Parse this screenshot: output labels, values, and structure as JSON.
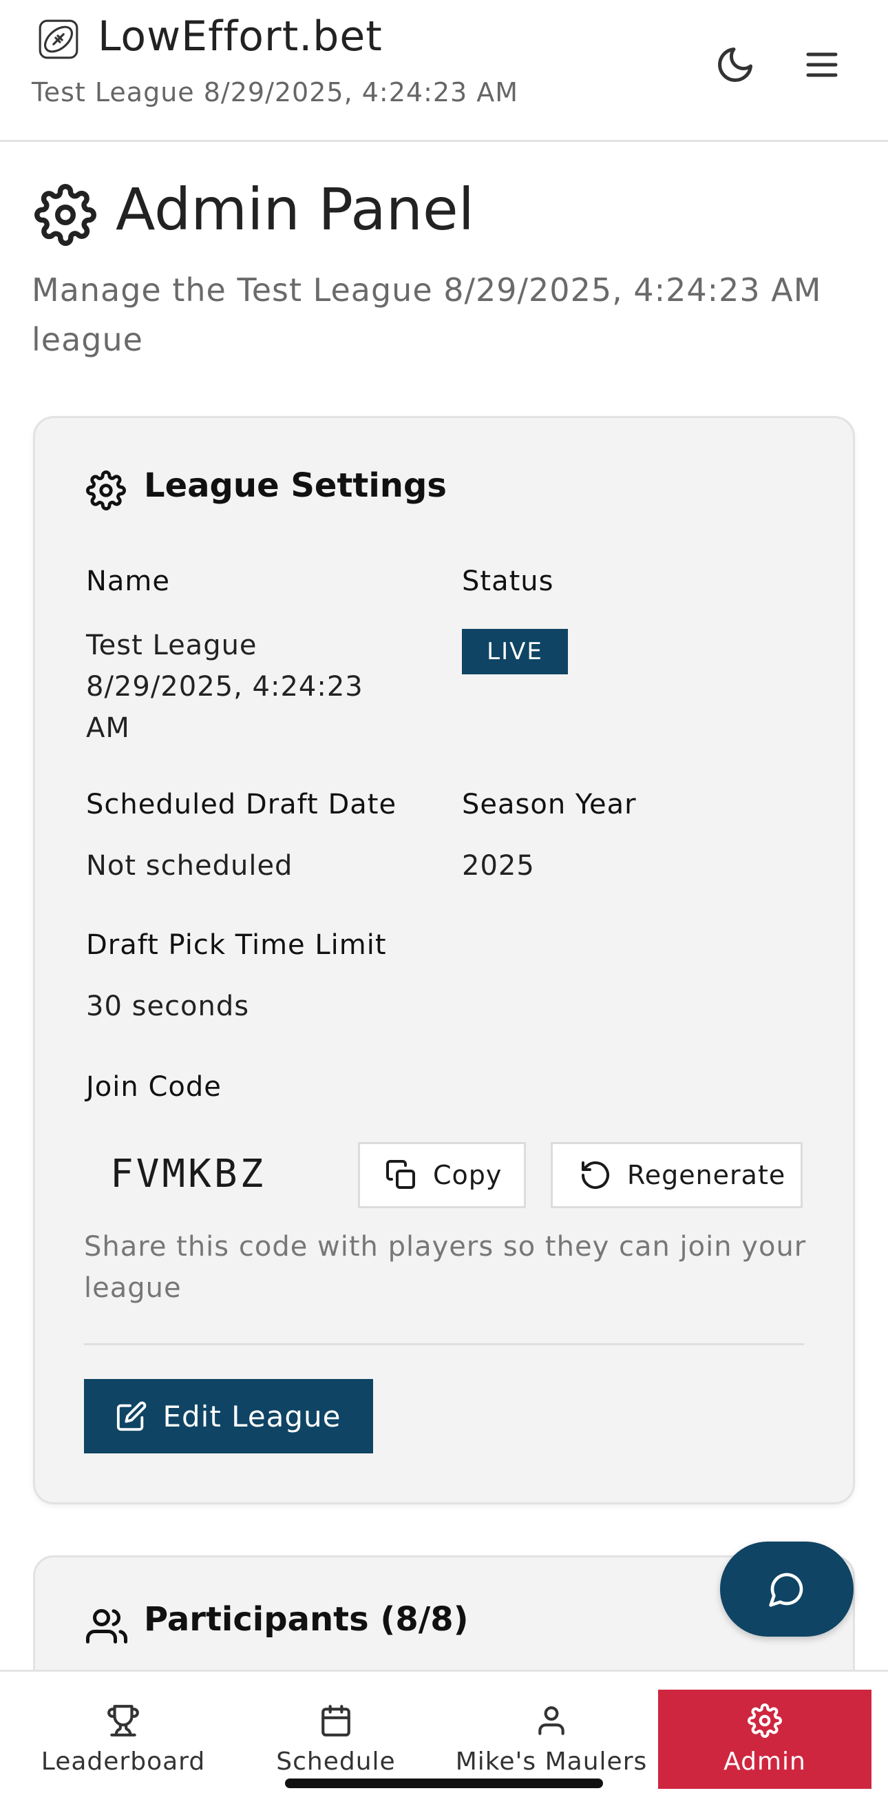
{
  "header": {
    "brand": "LowEffort.bet",
    "league_name": "Test League 8/29/2025, 4:24:23 AM",
    "logo_icon": "football-icon",
    "theme_icon": "moon-icon",
    "menu_icon": "hamburger-menu-icon"
  },
  "page": {
    "title": "Admin Panel",
    "description": "Manage the Test League 8/29/2025, 4:24:23 AM league",
    "title_icon": "gear-icon"
  },
  "settings_card": {
    "title": "League Settings",
    "fields": {
      "name_label": "Name",
      "name_value": "Test League 8/29/2025, 4:24:23 AM",
      "status_label": "Status",
      "status_value": "LIVE",
      "draft_date_label": "Scheduled Draft Date",
      "draft_date_value": "Not scheduled",
      "season_label": "Season Year",
      "season_value": "2025",
      "pick_limit_label": "Draft Pick Time Limit",
      "pick_limit_value": "30 seconds",
      "join_code_label": "Join Code",
      "join_code_value": "FVMKBZ"
    },
    "copy_label": "Copy",
    "regenerate_label": "Regenerate",
    "share_note": "Share this code with players so they can join your league",
    "edit_label": "Edit League"
  },
  "participants_card": {
    "title": "Participants (8/8)"
  },
  "bottom_nav": {
    "items": [
      {
        "label": "Leaderboard",
        "icon": "trophy-icon"
      },
      {
        "label": "Schedule",
        "icon": "calendar-icon"
      },
      {
        "label": "Mike's Maulers",
        "icon": "user-icon"
      },
      {
        "label": "Admin",
        "icon": "gear-icon"
      }
    ],
    "active": "Admin"
  },
  "colors": {
    "primary": "#0f4464",
    "active_nav": "#cf2640",
    "card_bg": "#f3f3f3"
  }
}
